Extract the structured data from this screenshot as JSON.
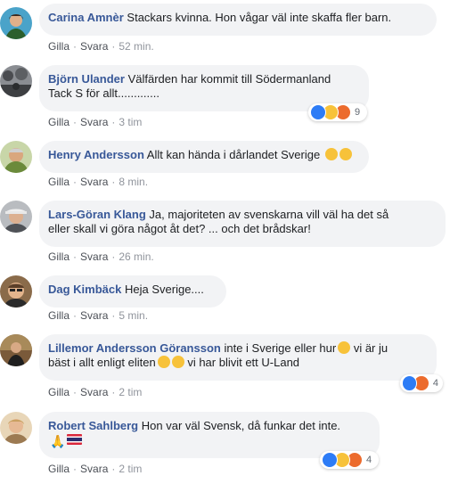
{
  "actions": {
    "like": "Gilla",
    "reply": "Svara",
    "sep": "·"
  },
  "comments": [
    {
      "author": "Carina Amnèr",
      "text": "Stackars kvinna. Hon vågar väl inte skaffa fler barn.",
      "time": "52 min."
    },
    {
      "author": "Björn Ulander",
      "text": "Välfärden har kommit till Södermanland",
      "text2": "Tack S för allt.............",
      "time": "3 tim",
      "reaction_count": "9"
    },
    {
      "author": "Henry Andersson",
      "text": "Allt kan hända i dårlandet Sverige",
      "time": "8 min."
    },
    {
      "author": "Lars-Göran Klang",
      "text": "Ja, majoriteten av svenskarna vill väl ha det så",
      "text2": "eller skall vi göra något åt det? ... och det brådskar!",
      "time": "26 min."
    },
    {
      "author": "Dag Kimbäck",
      "text": "Heja Sverige....",
      "time": "5 min."
    },
    {
      "author": "Lillemor Andersson Göransson",
      "text": "inte i Sverige eller hur",
      "text_b": "vi är ju",
      "text2": "bäst i allt enligt eliten",
      "text2_b": "vi har blivit ett U-Land",
      "time": "2 tim",
      "reaction_count": "4"
    },
    {
      "author": "Robert Sahlberg",
      "text": "Hon var väl Svensk, då funkar det inte.",
      "time": "2 tim",
      "reaction_count": "4"
    }
  ]
}
